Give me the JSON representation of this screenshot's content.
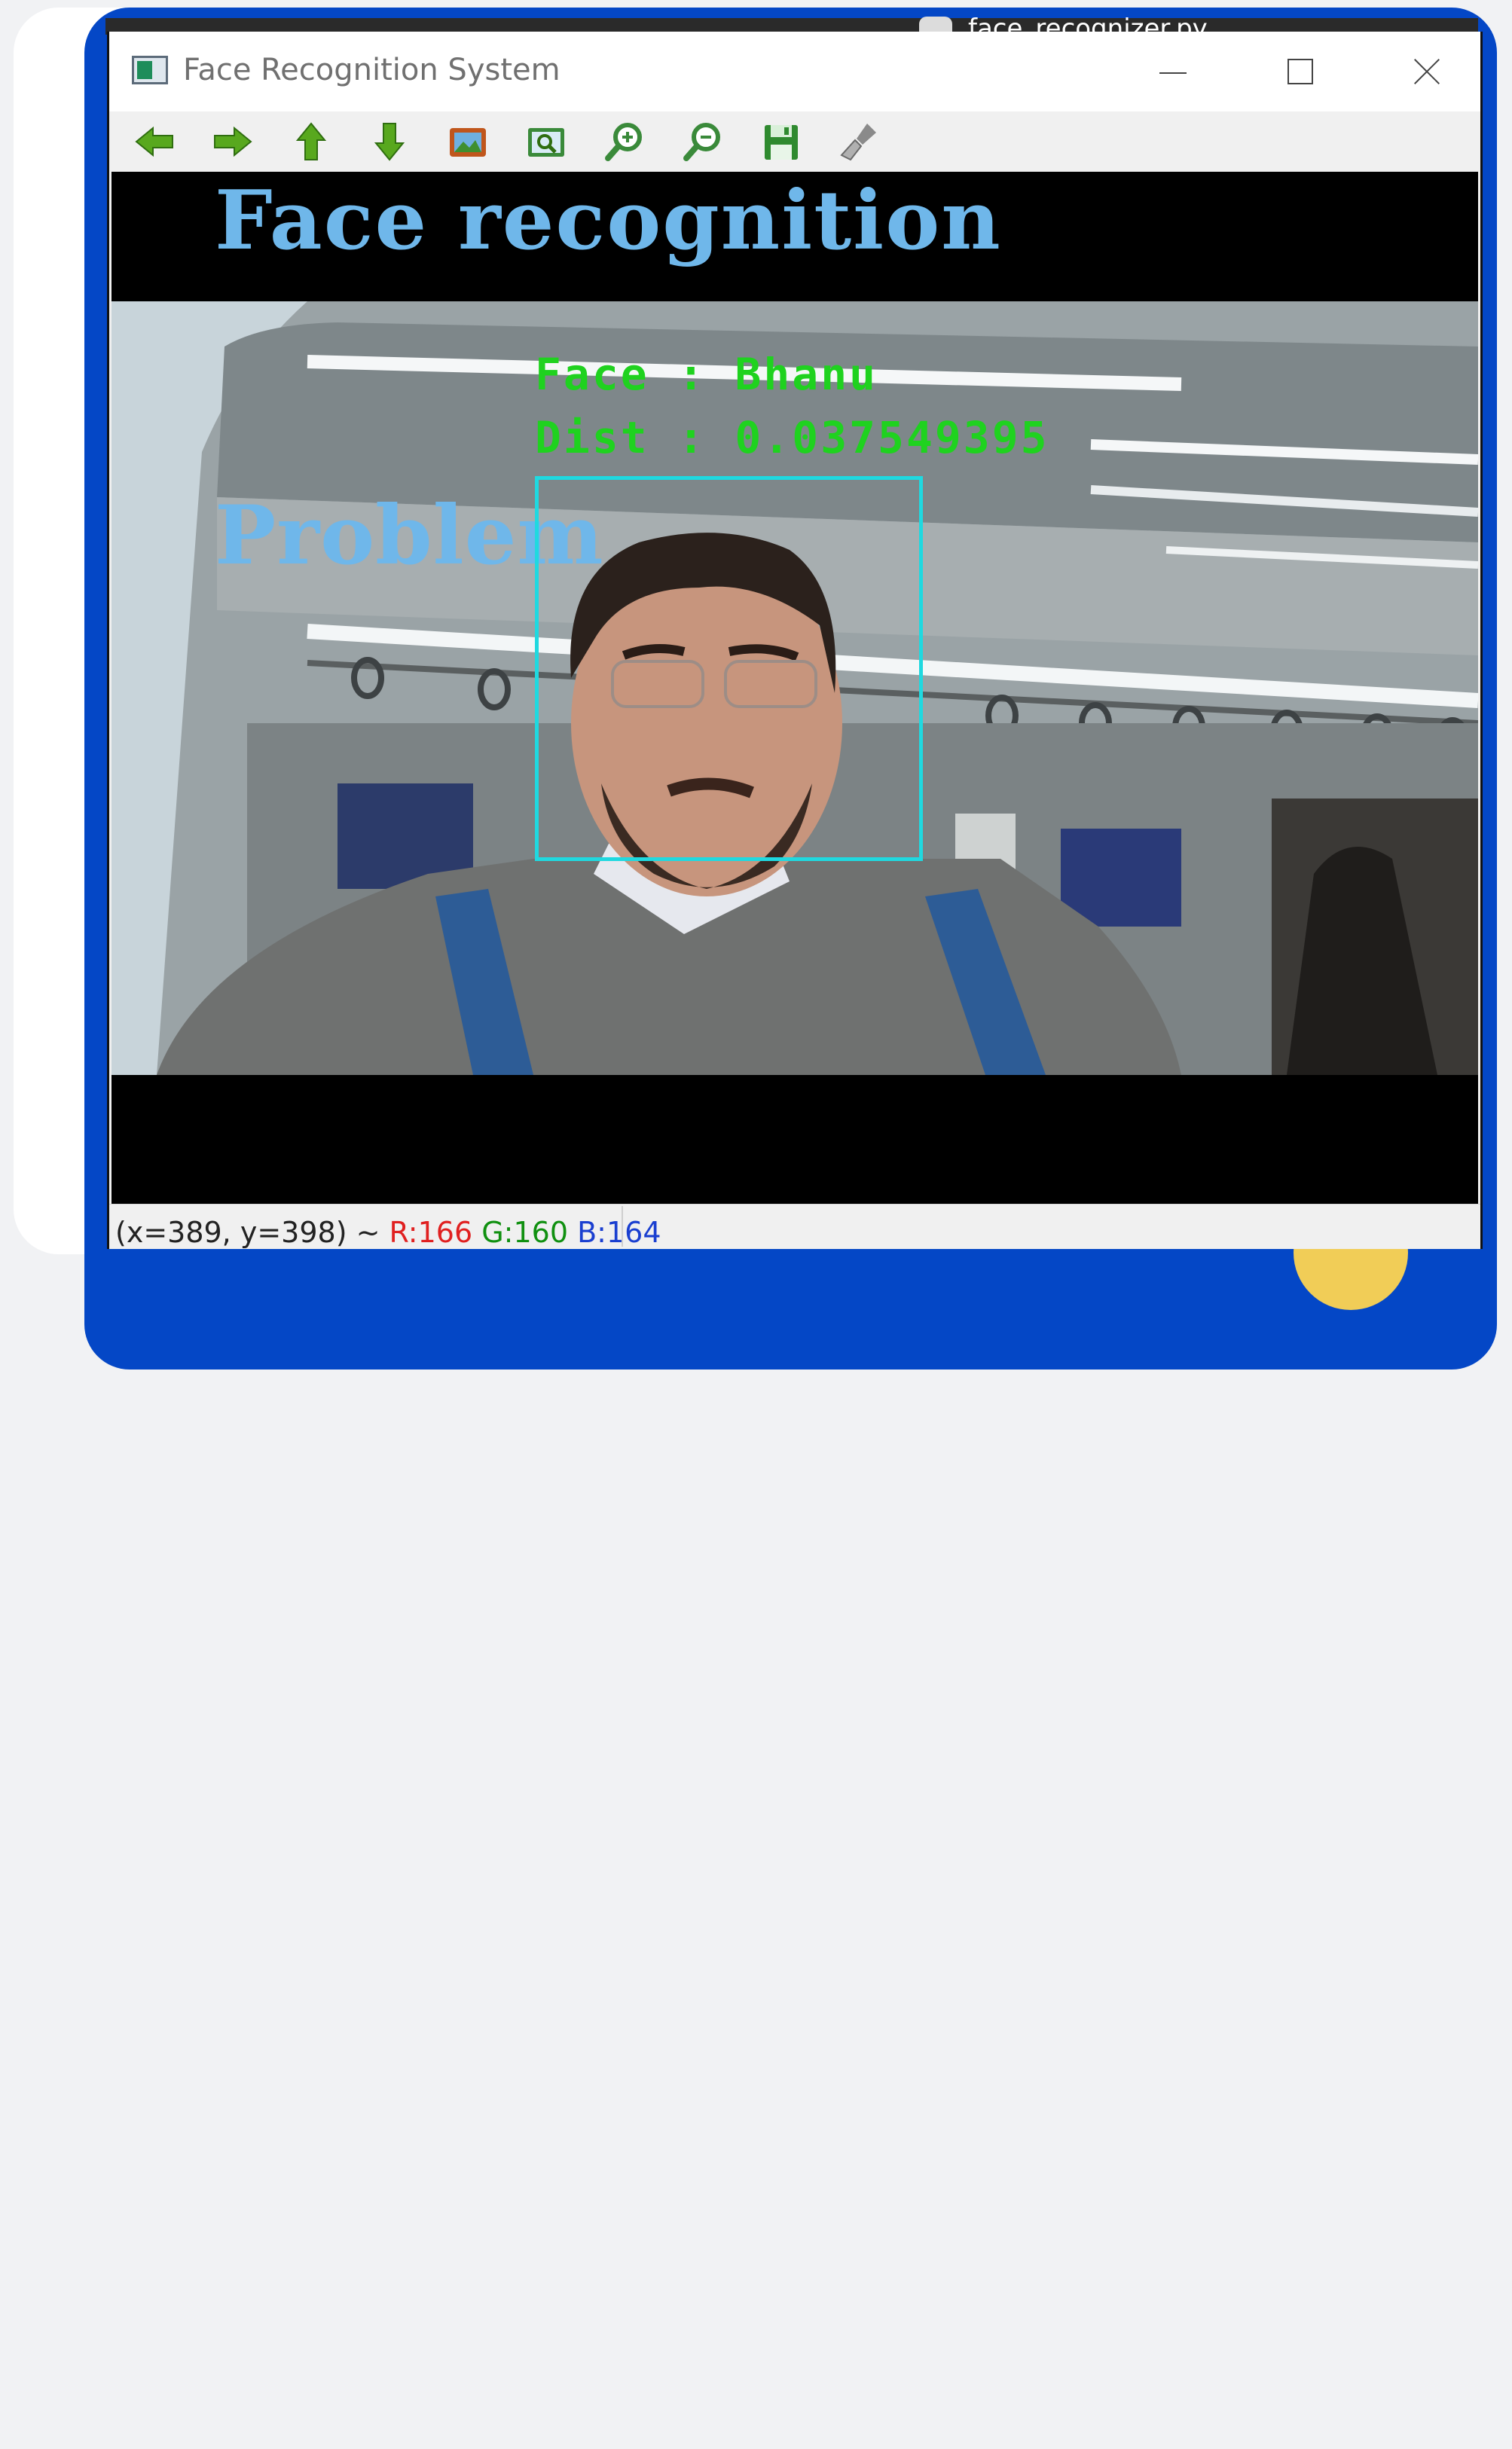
{
  "background_window": {
    "title": "face_recognizer.py"
  },
  "window": {
    "title": "Face Recognition System",
    "controls": [
      "minimize",
      "maximize",
      "close"
    ]
  },
  "toolbar": {
    "tools": [
      {
        "name": "pan-left-icon",
        "color": "#58a81e"
      },
      {
        "name": "pan-right-icon",
        "color": "#58a81e"
      },
      {
        "name": "pan-up-icon",
        "color": "#58a81e"
      },
      {
        "name": "pan-down-icon",
        "color": "#58a81e"
      },
      {
        "name": "zoom-fit-image-icon",
        "color": "#c0561c"
      },
      {
        "name": "zoom-fit-window-icon",
        "color": "#3a8a3a"
      },
      {
        "name": "zoom-in-icon",
        "color": "#3a8a3a"
      },
      {
        "name": "zoom-out-icon",
        "color": "#3a8a3a"
      },
      {
        "name": "save-icon",
        "color": "#2f8a2f"
      },
      {
        "name": "properties-brush-icon",
        "color": "#8a8a8a"
      }
    ]
  },
  "overlay": {
    "headline_1": "Face recognition",
    "headline_2": "Problem",
    "headline_color": "#6fb7ea"
  },
  "detection": {
    "face_label": "Face : Bhanu",
    "distance_label": "Dist : 0.037549395",
    "label_color": "#1fd21f",
    "box_color": "#1fd9e0"
  },
  "status": {
    "coords": "(x=389, y=398) ~",
    "r": "R:166",
    "g": "G:160",
    "b": "B:164"
  },
  "colors": {
    "frame_blue": "#0447c6",
    "accent_yellow": "#f1cd57"
  }
}
